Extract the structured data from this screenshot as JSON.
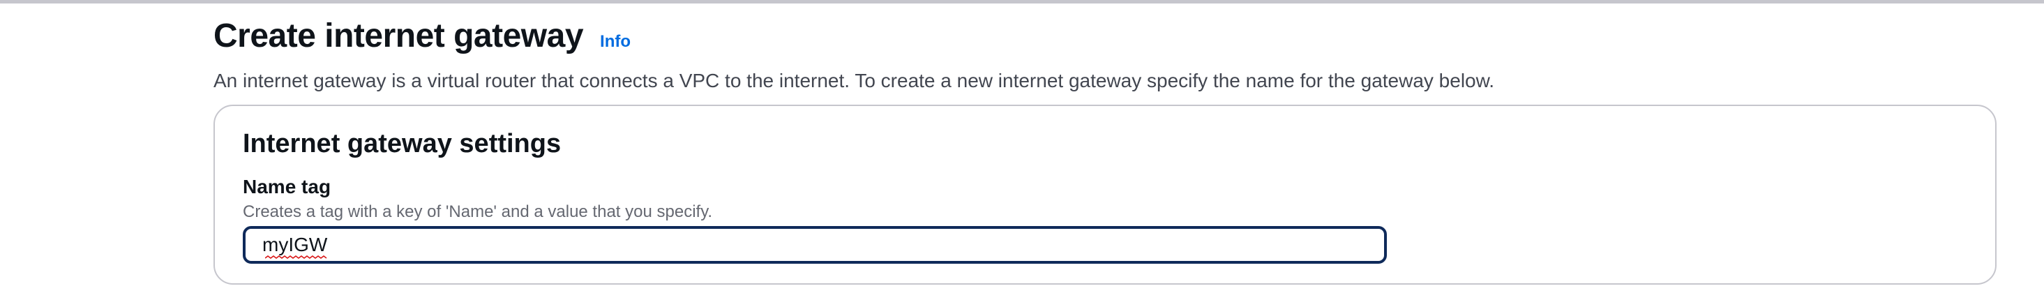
{
  "page": {
    "title": "Create internet gateway",
    "info_link": "Info",
    "description": "An internet gateway is a virtual router that connects a VPC to the internet. To create a new internet gateway specify the name for the gateway below."
  },
  "settings_section": {
    "title": "Internet gateway settings",
    "name_tag": {
      "label": "Name tag",
      "help_text": "Creates a tag with a key of 'Name' and a value that you specify.",
      "value": "myIGW"
    }
  },
  "colors": {
    "link": "#006ce0",
    "input_focus_border": "#0f2a5a",
    "card_border": "#c6c6cd",
    "spellcheck_underline": "#d91515"
  }
}
